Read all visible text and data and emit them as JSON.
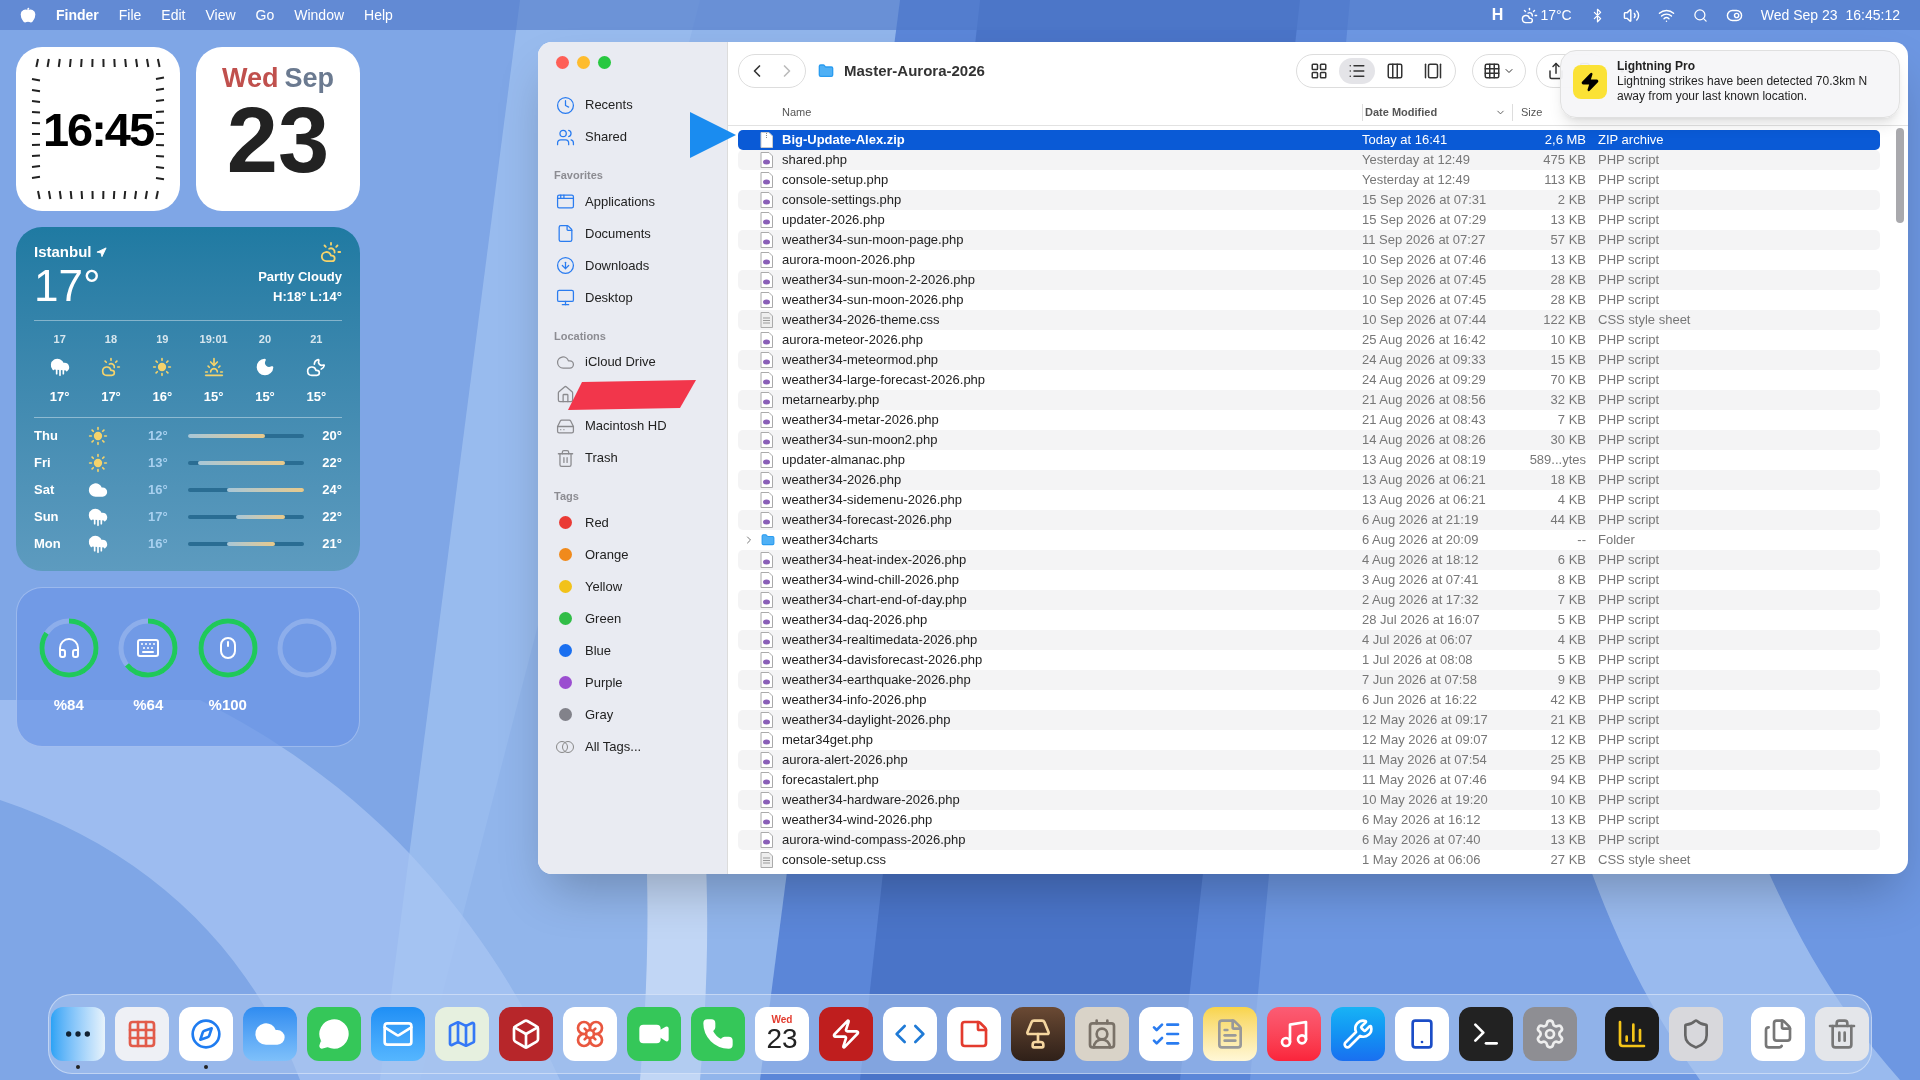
{
  "menu_bar": {
    "app": "Finder",
    "menus": [
      "File",
      "Edit",
      "View",
      "Go",
      "Window",
      "Help"
    ],
    "extra": "H",
    "temperature": "17°C",
    "date": "Wed Sep 23",
    "time": "16:45:12"
  },
  "clock_widget": {
    "time": "16:45"
  },
  "calendar_widget": {
    "weekday": "Wed",
    "month": "Sep",
    "day": "23"
  },
  "weather_widget": {
    "city": "Istanbul",
    "temperature": "17°",
    "condition": "Partly Cloudy",
    "high_low": "H:18° L:14°",
    "hourly": [
      {
        "time": "17",
        "kind": "rain",
        "temp": "17°"
      },
      {
        "time": "18",
        "kind": "partly",
        "temp": "17°"
      },
      {
        "time": "19",
        "kind": "sun",
        "temp": "16°"
      },
      {
        "time": "19:01",
        "kind": "sunset",
        "temp": "15°"
      },
      {
        "time": "20",
        "kind": "moon",
        "temp": "15°"
      },
      {
        "time": "21",
        "kind": "cloudmoon",
        "temp": "15°"
      }
    ],
    "daily": [
      {
        "day": "Thu",
        "kind": "sun",
        "low": "12°",
        "high": "20°"
      },
      {
        "day": "Fri",
        "kind": "sun",
        "low": "13°",
        "high": "22°"
      },
      {
        "day": "Sat",
        "kind": "cloud",
        "low": "16°",
        "high": "24°"
      },
      {
        "day": "Sun",
        "kind": "rain",
        "low": "17°",
        "high": "22°"
      },
      {
        "day": "Mon",
        "kind": "rain",
        "low": "16°",
        "high": "21°"
      }
    ]
  },
  "battery_widget": [
    {
      "kind": "earbuds",
      "level": 0.84,
      "reading": "%84"
    },
    {
      "kind": "keyboard",
      "level": 0.64,
      "reading": "%64"
    },
    {
      "kind": "mouse",
      "level": 1,
      "reading": "%100"
    },
    {
      "kind": "empty"
    }
  ],
  "finder": {
    "title": "Master-Aurora-2026",
    "views": [
      {
        "kind": "icons",
        "selected": false
      },
      {
        "kind": "list",
        "selected": true
      },
      {
        "kind": "columns",
        "selected": false
      },
      {
        "kind": "gallery",
        "selected": false
      }
    ],
    "sidebar": [
      {
        "items": [
          {
            "kind": "recents",
            "label": "Recents"
          },
          {
            "kind": "shared",
            "label": "Shared"
          }
        ]
      },
      {
        "heading": "Favorites",
        "items": [
          {
            "kind": "apps",
            "label": "Applications"
          },
          {
            "kind": "docs",
            "label": "Documents"
          },
          {
            "kind": "downloads",
            "label": "Downloads"
          },
          {
            "kind": "desktop",
            "label": "Desktop"
          }
        ]
      },
      {
        "heading": "Locations",
        "items": [
          {
            "kind": "icloud",
            "label": "iCloud Drive"
          },
          {
            "kind": "home",
            "redacted": true
          },
          {
            "kind": "disk",
            "label": "Macintosh HD"
          },
          {
            "kind": "trash",
            "label": "Trash"
          }
        ]
      },
      {
        "heading": "Tags",
        "items": [
          {
            "kind": "tag",
            "label": "Red",
            "color": "#ea3a35"
          },
          {
            "kind": "tag",
            "label": "Orange",
            "color": "#f08a1c"
          },
          {
            "kind": "tag",
            "label": "Yellow",
            "color": "#f2c21a"
          },
          {
            "kind": "tag",
            "label": "Green",
            "color": "#31bd47"
          },
          {
            "kind": "tag",
            "label": "Blue",
            "color": "#1a6ff0"
          },
          {
            "kind": "tag",
            "label": "Purple",
            "color": "#9b4ed0"
          },
          {
            "kind": "tag",
            "label": "Gray",
            "color": "#82828a"
          },
          {
            "kind": "alltags",
            "label": "All Tags..."
          }
        ]
      }
    ],
    "columns": [
      "Name",
      "Date Modified",
      "Size"
    ],
    "rows": [
      {
        "name": "Big-Update-Alex.zip",
        "date": "Today at 16:41",
        "size": "2,6 MB",
        "type": "ZIP archive",
        "kind": "zip",
        "selected": true
      },
      {
        "name": "shared.php",
        "date": "Yesterday at 12:49",
        "size": "475 KB",
        "type": "PHP script",
        "kind": "php",
        "selected": false
      },
      {
        "name": "console-setup.php",
        "date": "Yesterday at 12:49",
        "size": "113 KB",
        "type": "PHP script",
        "kind": "php",
        "selected": false
      },
      {
        "name": "console-settings.php",
        "date": "15 Sep 2026 at 07:31",
        "size": "2 KB",
        "type": "PHP script",
        "kind": "php",
        "selected": false
      },
      {
        "name": "updater-2026.php",
        "date": "15 Sep 2026 at 07:29",
        "size": "13 KB",
        "type": "PHP script",
        "kind": "php",
        "selected": false
      },
      {
        "name": "weather34-sun-moon-page.php",
        "date": "11 Sep 2026 at 07:27",
        "size": "57 KB",
        "type": "PHP script",
        "kind": "php",
        "selected": false
      },
      {
        "name": "aurora-moon-2026.php",
        "date": "10 Sep 2026 at 07:46",
        "size": "13 KB",
        "type": "PHP script",
        "kind": "php",
        "selected": false
      },
      {
        "name": "weather34-sun-moon-2-2026.php",
        "date": "10 Sep 2026 at 07:45",
        "size": "28 KB",
        "type": "PHP script",
        "kind": "php",
        "selected": false
      },
      {
        "name": "weather34-sun-moon-2026.php",
        "date": "10 Sep 2026 at 07:45",
        "size": "28 KB",
        "type": "PHP script",
        "kind": "php",
        "selected": false
      },
      {
        "name": "weather34-2026-theme.css",
        "date": "10 Sep 2026 at 07:44",
        "size": "122 KB",
        "type": "CSS style sheet",
        "kind": "css",
        "selected": false
      },
      {
        "name": "aurora-meteor-2026.php",
        "date": "25 Aug 2026 at 16:42",
        "size": "10 KB",
        "type": "PHP script",
        "kind": "php",
        "selected": false
      },
      {
        "name": "weather34-meteormod.php",
        "date": "24 Aug 2026 at 09:33",
        "size": "15 KB",
        "type": "PHP script",
        "kind": "php",
        "selected": false
      },
      {
        "name": "weather34-large-forecast-2026.php",
        "date": "24 Aug 2026 at 09:29",
        "size": "70 KB",
        "type": "PHP script",
        "kind": "php",
        "selected": false
      },
      {
        "name": "metarnearby.php",
        "date": "21 Aug 2026 at 08:56",
        "size": "32 KB",
        "type": "PHP script",
        "kind": "php",
        "selected": false
      },
      {
        "name": "weather34-metar-2026.php",
        "date": "21 Aug 2026 at 08:43",
        "size": "7 KB",
        "type": "PHP script",
        "kind": "php",
        "selected": false
      },
      {
        "name": "weather34-sun-moon2.php",
        "date": "14 Aug 2026 at 08:26",
        "size": "30 KB",
        "type": "PHP script",
        "kind": "php",
        "selected": false
      },
      {
        "name": "updater-almanac.php",
        "date": "13 Aug 2026 at 08:19",
        "size": "589...ytes",
        "type": "PHP script",
        "kind": "php",
        "selected": false
      },
      {
        "name": "weather34-2026.php",
        "date": "13 Aug 2026 at 06:21",
        "size": "18 KB",
        "type": "PHP script",
        "kind": "php",
        "selected": false
      },
      {
        "name": "weather34-sidemenu-2026.php",
        "date": "13 Aug 2026 at 06:21",
        "size": "4 KB",
        "type": "PHP script",
        "kind": "php",
        "selected": false
      },
      {
        "name": "weather34-forecast-2026.php",
        "date": "6 Aug 2026 at 21:19",
        "size": "44 KB",
        "type": "PHP script",
        "kind": "php",
        "selected": false
      },
      {
        "name": "weather34charts",
        "date": "6 Aug 2026 at 20:09",
        "size": "--",
        "type": "Folder",
        "kind": "folder",
        "selected": false,
        "expanded": false
      },
      {
        "name": "weather34-heat-index-2026.php",
        "date": "4 Aug 2026 at 18:12",
        "size": "6 KB",
        "type": "PHP script",
        "kind": "php",
        "selected": false
      },
      {
        "name": "weather34-wind-chill-2026.php",
        "date": "3 Aug 2026 at 07:41",
        "size": "8 KB",
        "type": "PHP script",
        "kind": "php",
        "selected": false
      },
      {
        "name": "weather34-chart-end-of-day.php",
        "date": "2 Aug 2026 at 17:32",
        "size": "7 KB",
        "type": "PHP script",
        "kind": "php",
        "selected": false
      },
      {
        "name": "weather34-daq-2026.php",
        "date": "28 Jul 2026 at 16:07",
        "size": "5 KB",
        "type": "PHP script",
        "kind": "php",
        "selected": false
      },
      {
        "name": "weather34-realtimedata-2026.php",
        "date": "4 Jul 2026 at 06:07",
        "size": "4 KB",
        "type": "PHP script",
        "kind": "php",
        "selected": false
      },
      {
        "name": "weather34-davisforecast-2026.php",
        "date": "1 Jul 2026 at 08:08",
        "size": "5 KB",
        "type": "PHP script",
        "kind": "php",
        "selected": false
      },
      {
        "name": "weather34-earthquake-2026.php",
        "date": "7 Jun 2026 at 07:58",
        "size": "9 KB",
        "type": "PHP script",
        "kind": "php",
        "selected": false
      },
      {
        "name": "weather34-info-2026.php",
        "date": "6 Jun 2026 at 16:22",
        "size": "42 KB",
        "type": "PHP script",
        "kind": "php",
        "selected": false
      },
      {
        "name": "weather34-daylight-2026.php",
        "date": "12 May 2026 at 09:17",
        "size": "21 KB",
        "type": "PHP script",
        "kind": "php",
        "selected": false
      },
      {
        "name": "metar34get.php",
        "date": "12 May 2026 at 09:07",
        "size": "12 KB",
        "type": "PHP script",
        "kind": "php",
        "selected": false
      },
      {
        "name": "aurora-alert-2026.php",
        "date": "11 May 2026 at 07:54",
        "size": "25 KB",
        "type": "PHP script",
        "kind": "php",
        "selected": false
      },
      {
        "name": "forecastalert.php",
        "date": "11 May 2026 at 07:46",
        "size": "94 KB",
        "type": "PHP script",
        "kind": "php",
        "selected": false
      },
      {
        "name": "weather34-hardware-2026.php",
        "date": "10 May 2026 at 19:20",
        "size": "10 KB",
        "type": "PHP script",
        "kind": "php",
        "selected": false
      },
      {
        "name": "weather34-wind-2026.php",
        "date": "6 May 2026 at 16:12",
        "size": "13 KB",
        "type": "PHP script",
        "kind": "php",
        "selected": false
      },
      {
        "name": "aurora-wind-compass-2026.php",
        "date": "6 May 2026 at 07:40",
        "size": "13 KB",
        "type": "PHP script",
        "kind": "php",
        "selected": false
      },
      {
        "name": "console-setup.css",
        "date": "1 May 2026 at 06:06",
        "size": "27 KB",
        "type": "CSS style sheet",
        "kind": "css",
        "selected": false
      }
    ]
  },
  "notification": {
    "app": "Lightning Pro",
    "message": "Lightning strikes have been detected 70.3km N away from your last known location."
  },
  "dock": [
    {
      "kind": "finder",
      "running": true
    },
    {
      "kind": "launchpad",
      "running": false
    },
    {
      "kind": "safari",
      "running": true
    },
    {
      "kind": "weather",
      "running": false
    },
    {
      "kind": "messages",
      "running": false
    },
    {
      "kind": "mail",
      "running": false
    },
    {
      "kind": "maps",
      "running": false
    },
    {
      "kind": "box",
      "running": false
    },
    {
      "kind": "photos",
      "running": false
    },
    {
      "kind": "facetime",
      "running": false
    },
    {
      "kind": "phone",
      "running": false
    },
    {
      "kind": "calendar",
      "running": false,
      "weekday": "Wed",
      "day": "23"
    },
    {
      "kind": "zigzag",
      "running": false
    },
    {
      "kind": "code",
      "running": false
    },
    {
      "kind": "tile",
      "running": false
    },
    {
      "kind": "lamp",
      "running": false
    },
    {
      "kind": "contacts",
      "running": false
    },
    {
      "kind": "reminders",
      "running": false
    },
    {
      "kind": "notes",
      "running": false
    },
    {
      "kind": "music",
      "running": false
    },
    {
      "kind": "appstore",
      "running": false
    },
    {
      "kind": "device",
      "running": false
    },
    {
      "kind": "terminal",
      "running": false
    },
    {
      "kind": "settings",
      "running": false
    },
    {
      "kind": "separator"
    },
    {
      "kind": "bars",
      "running": false
    },
    {
      "kind": "shield",
      "running": false
    },
    {
      "kind": "separator"
    },
    {
      "kind": "files",
      "running": false
    },
    {
      "kind": "trash",
      "running": false
    }
  ]
}
